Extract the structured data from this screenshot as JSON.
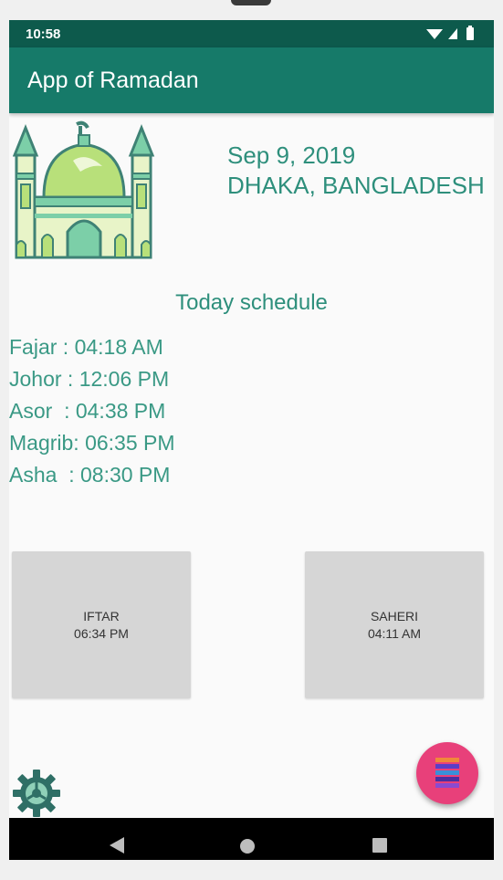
{
  "status_bar": {
    "time": "10:58"
  },
  "app_bar": {
    "title": "App of Ramadan"
  },
  "header": {
    "date": "Sep 9, 2019",
    "location": "DHAKA, BANGLADESH"
  },
  "schedule": {
    "title": "Today schedule",
    "prayers": [
      "Fajar : 04:18 AM",
      "Johor : 12:06 PM",
      "Asor  : 04:38 PM",
      "Magrib: 06:35 PM",
      "Asha  : 08:30 PM"
    ]
  },
  "cards": {
    "iftar": {
      "label": "IFTAR",
      "time": "06:34 PM"
    },
    "saheri": {
      "label": "SAHERI",
      "time": "04:11 AM"
    }
  },
  "icons": {
    "logo": "mosque-icon",
    "settings": "gear-icon",
    "fab": "menu-stack-icon",
    "nav": [
      "back-icon",
      "home-icon",
      "recents-icon"
    ]
  },
  "colors": {
    "status_bar": "#0d5a4c",
    "app_bar": "#167a69",
    "accent_text": "#2e8f7c",
    "fab": "#e8407a",
    "card": "#d6d6d6"
  }
}
